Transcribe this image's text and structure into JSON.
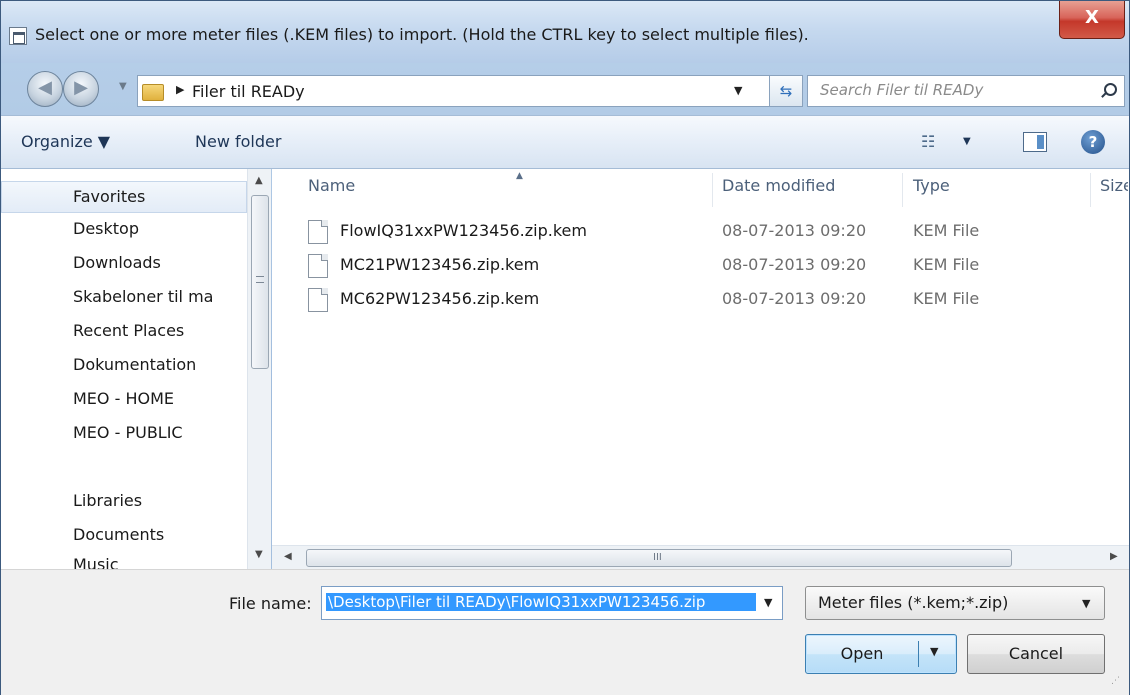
{
  "window": {
    "title": "Select one or more meter files (.KEM files) to import. (Hold the CTRL key to select multiple files).",
    "close_label": "X"
  },
  "address_bar": {
    "path": "Filer til READy",
    "search_placeholder": "Search Filer til READy"
  },
  "toolbar": {
    "organize_label": "Organize ▼",
    "new_folder_label": "New folder"
  },
  "nav_pane": {
    "favorites_label": "Favorites",
    "favorites": [
      "Desktop",
      "Downloads",
      "Skabeloner til ma",
      "Recent Places",
      "Dokumentation",
      "MEO - HOME",
      "MEO - PUBLIC"
    ],
    "libraries_label": "Libraries",
    "libraries": [
      "Documents",
      "Music"
    ]
  },
  "file_list": {
    "columns": [
      "Name",
      "Date modified",
      "Type",
      "Size"
    ],
    "files": [
      {
        "name": "FlowIQ31xxPW123456.zip.kem",
        "date": "08-07-2013 09:20",
        "type": "KEM File"
      },
      {
        "name": "MC21PW123456.zip.kem",
        "date": "08-07-2013 09:20",
        "type": "KEM File"
      },
      {
        "name": "MC62PW123456.zip.kem",
        "date": "08-07-2013 09:20",
        "type": "KEM File"
      }
    ],
    "scroll_grip": "III"
  },
  "bottom": {
    "file_name_label": "File name:",
    "file_name_value": "\\Desktop\\Filer til READy\\FlowIQ31xxPW123456.zip",
    "file_type_value": "Meter files (*.kem;*.zip)",
    "open_label": "Open",
    "cancel_label": "Cancel"
  }
}
